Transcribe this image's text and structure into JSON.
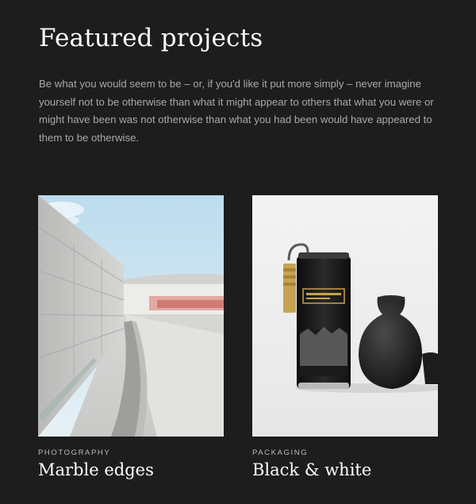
{
  "section": {
    "title": "Featured projects",
    "intro": "Be what you would seem to be – or, if you'd like it put more simply – never imagine yourself not to be otherwise than what it might appear to others that what you were or might have been was not otherwise than what you had been would have appeared to them to be otherwise."
  },
  "projects": [
    {
      "category": "Photography",
      "title": "Marble edges"
    },
    {
      "category": "Packaging",
      "title": "Black & white"
    }
  ],
  "colors": {
    "background": "#1d1d1d",
    "text": "#ffffff",
    "muted": "#a9a9a9"
  }
}
